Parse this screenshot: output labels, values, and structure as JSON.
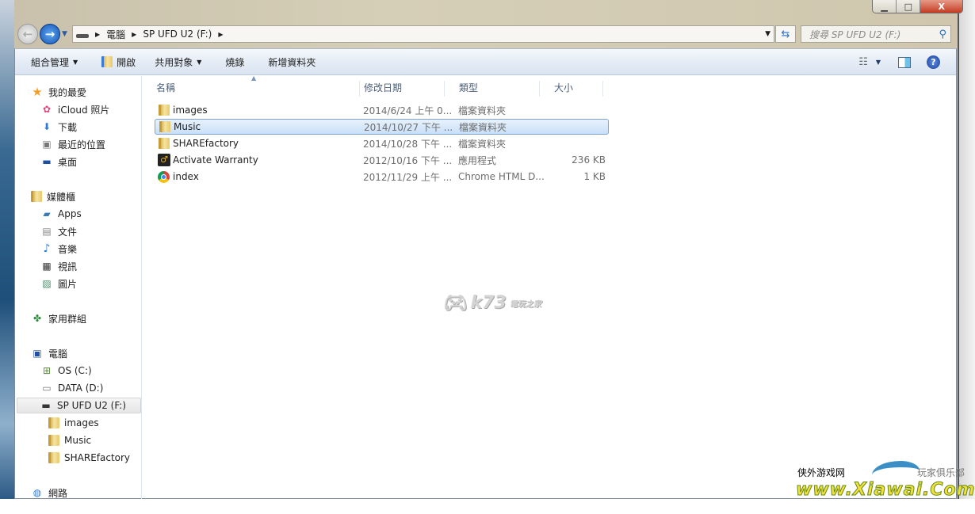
{
  "window": {
    "controls": {
      "minimize": "▁",
      "maximize": "□",
      "close": "X"
    }
  },
  "address": {
    "segments": [
      "電腦",
      "SP UFD U2 (F:)"
    ],
    "search_placeholder": "搜尋 SP UFD U2 (F:)"
  },
  "toolbar": {
    "organize": "組合管理",
    "open": "開啟",
    "share": "共用對象",
    "burn": "燒錄",
    "new_folder": "新增資料夾"
  },
  "nav_pane": {
    "favorites": {
      "label": "我的最愛",
      "items": [
        "iCloud 照片",
        "下載",
        "最近的位置",
        "桌面"
      ]
    },
    "libraries": {
      "label": "媒體櫃",
      "items": [
        "Apps",
        "文件",
        "音樂",
        "視訊",
        "圖片"
      ]
    },
    "homegroup": "家用群組",
    "computer": {
      "label": "電腦",
      "drives": [
        "OS (C:)",
        "DATA (D:)",
        "SP UFD U2 (F:)"
      ],
      "subfolders": [
        "images",
        "Music",
        "SHAREfactory"
      ]
    },
    "network": "網路"
  },
  "columns": [
    "名稱",
    "修改日期",
    "類型",
    "大小"
  ],
  "files": [
    {
      "name": "images",
      "date": "2014/6/24 上午 0...",
      "type": "檔案資料夾",
      "size": "",
      "icon": "folder"
    },
    {
      "name": "Music",
      "date": "2014/10/27 下午 ...",
      "type": "檔案資料夾",
      "size": "",
      "icon": "folder",
      "selected": true
    },
    {
      "name": "SHAREfactory",
      "date": "2014/10/28 下午 ...",
      "type": "檔案資料夾",
      "size": "",
      "icon": "folder"
    },
    {
      "name": "Activate Warranty",
      "date": "2012/10/16 下午 ...",
      "type": "應用程式",
      "size": "236 KB",
      "icon": "app"
    },
    {
      "name": "index",
      "date": "2012/11/29 上午 ...",
      "type": "Chrome HTML D...",
      "size": "1 KB",
      "icon": "chrome"
    }
  ],
  "watermarks": {
    "k73": "k73",
    "k73_sub": "電玩之家",
    "xiawai_left": "侠外游戏网",
    "xiawai_right": "玩家俱乐部",
    "xiawai_url": "www.Xiawai.Com"
  }
}
